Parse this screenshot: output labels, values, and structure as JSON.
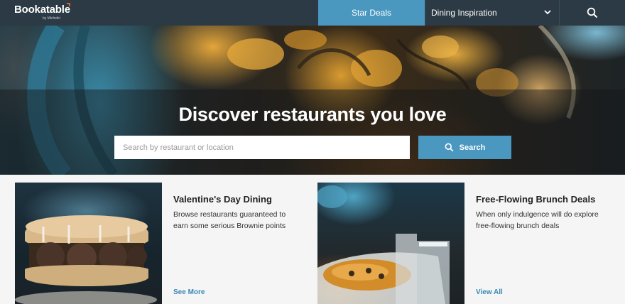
{
  "nav": {
    "logo": "Bookatable",
    "logo_sub": "by Michelin",
    "star_deals": "Star Deals",
    "dining_inspiration": "Dining Inspiration",
    "icons": {
      "dropdown": "chevron-down-icon",
      "search": "search-icon"
    }
  },
  "hero": {
    "title": "Discover restaurants you love",
    "search_placeholder": "Search by restaurant or location",
    "search_value": "",
    "search_button": "Search"
  },
  "cards": [
    {
      "title": "Valentine's Day Dining",
      "description": "Browse restaurants guaranteed to earn some serious Brownie points",
      "link": "See More"
    },
    {
      "title": "Free-Flowing Brunch Deals",
      "description": "When only indulgence will do  explore free-flowing brunch deals",
      "link": "View All"
    }
  ],
  "colors": {
    "nav_bg": "#2b3a44",
    "accent": "#4a97bf",
    "link": "#3b88b5",
    "logo_mark": "#e0622b"
  }
}
